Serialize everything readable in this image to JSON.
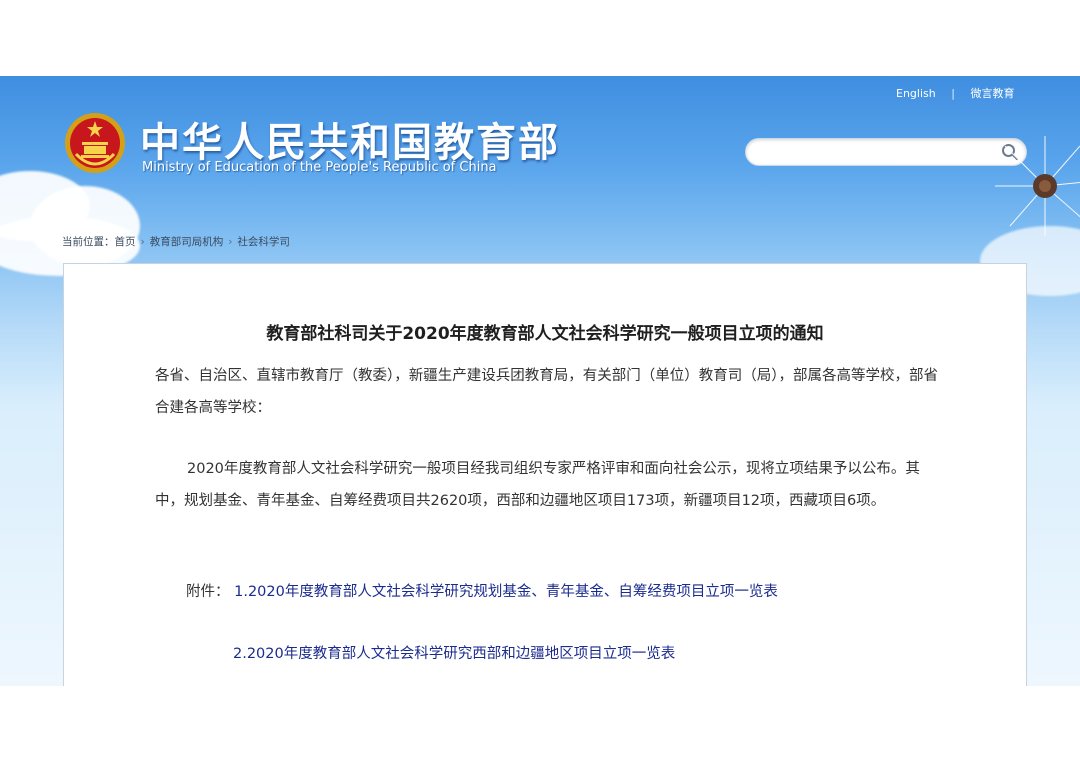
{
  "header": {
    "title": "中华人民共和国教育部",
    "subtitle": "Ministry of Education of the People's Republic of China",
    "links": {
      "english": "English",
      "weibo": "微言教育"
    }
  },
  "search": {
    "placeholder": ""
  },
  "breadcrumb": {
    "prefix": "当前位置：",
    "items": [
      "首页",
      "教育部司局机构",
      "社会科学司"
    ]
  },
  "article": {
    "title": "教育部社科司关于2020年度教育部人文社会科学研究一般项目立项的通知",
    "greeting": "各省、自治区、直辖市教育厅（教委），新疆生产建设兵团教育局，有关部门（单位）教育司（局），部属各高等学校，部省合建各高等学校：",
    "body": "2020年度教育部人文社会科学研究一般项目经我司组织专家严格评审和面向社会公示，现将立项结果予以公布。其中，规划基金、青年基金、自筹经费项目共2620项，西部和边疆地区项目173项，新疆项目12项，西藏项目6项。",
    "attachment_label": "附件：",
    "attachments": [
      "1.2020年度教育部人文社会科学研究规划基金、青年基金、自筹经费项目立项一览表",
      "2.2020年度教育部人文社会科学研究西部和边疆地区项目立项一览表"
    ]
  },
  "colors": {
    "header_blue": "#3f8ee0",
    "link": "#1b2c8f",
    "text": "#333333"
  },
  "icons": {
    "emblem": "national-emblem-icon",
    "search": "search-icon",
    "breadcrumb_arrow": "chevron-right-icon"
  }
}
